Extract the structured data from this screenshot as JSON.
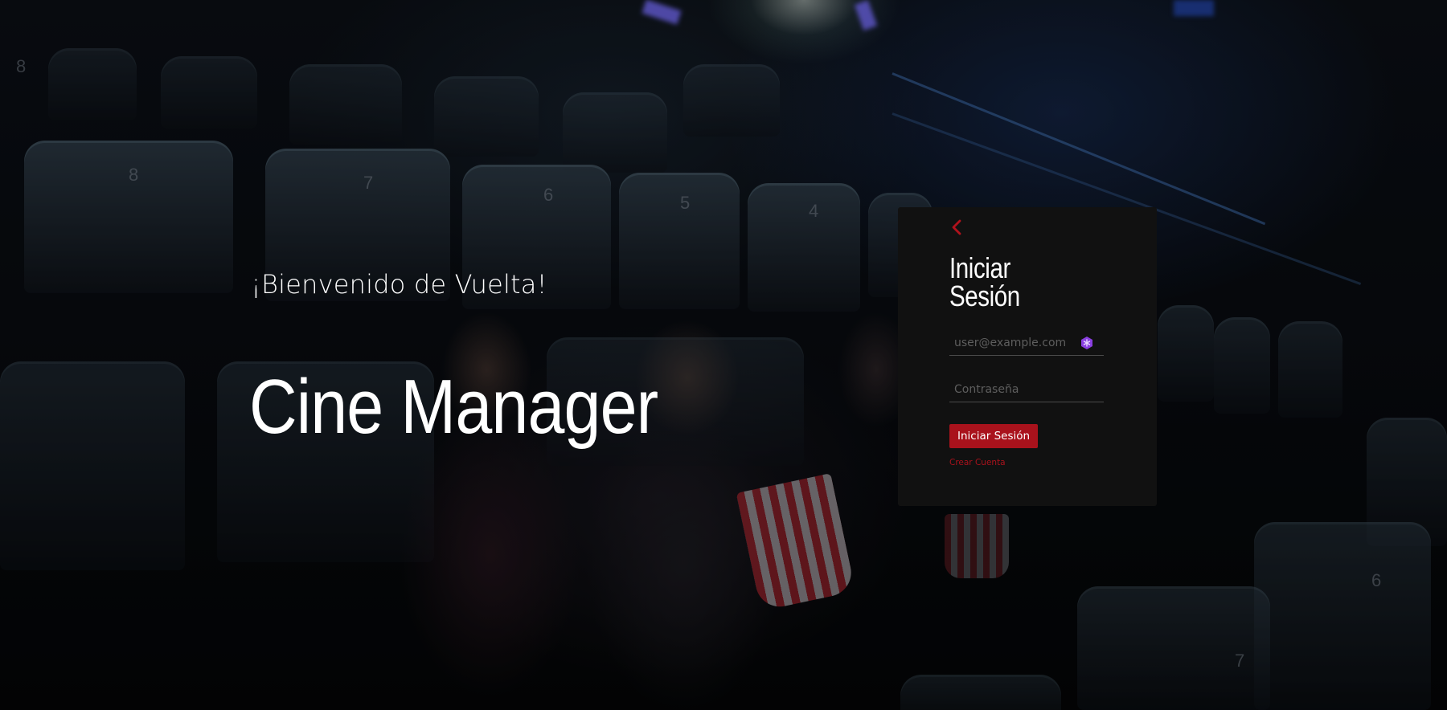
{
  "hero": {
    "welcome_text": "¡Bienvenido de Vuelta!",
    "app_name": "Cine Manager"
  },
  "login": {
    "title_line1": "Iniciar",
    "title_line2": "Sesión",
    "email_placeholder": "user@example.com",
    "email_value": "",
    "password_placeholder": "Contraseña",
    "password_value": "",
    "submit_label": "Iniciar Sesión",
    "create_account_label": "Crear Cuenta",
    "back_icon": "chevron-left-icon",
    "extension_icon": "password-manager-icon"
  },
  "colors": {
    "accent": "#a9121c",
    "card_background": "#111111",
    "text_primary": "#ffffff"
  }
}
